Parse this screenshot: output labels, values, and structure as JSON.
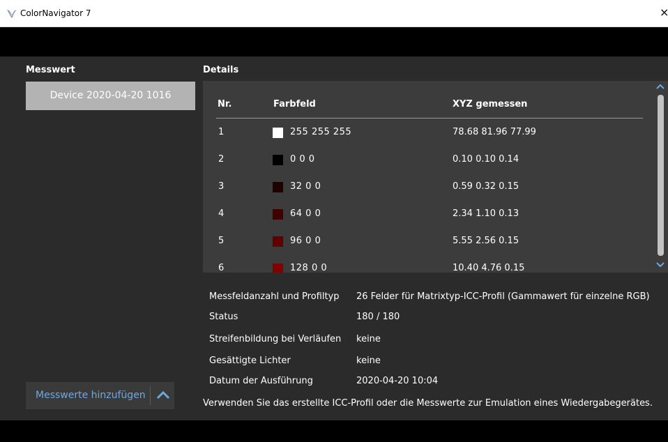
{
  "window": {
    "title": "ColorNavigator 7",
    "close_glyph": "×"
  },
  "left": {
    "heading": "Messwert",
    "items": [
      {
        "label": "Device 2020-04-20 1016",
        "selected": true
      }
    ],
    "add_button": {
      "label": "Messwerte hinzufügen",
      "icon": "chevron-up-icon"
    }
  },
  "details": {
    "heading": "Details",
    "columns": {
      "nr": "Nr.",
      "farbfeld": "Farbfeld",
      "xyz": "XYZ gemessen"
    },
    "rows": [
      {
        "nr": "1",
        "rgb": "255 255 255",
        "color": "#ffffff",
        "xyz": "78.68 81.96 77.99"
      },
      {
        "nr": "2",
        "rgb": "0 0 0",
        "color": "#000000",
        "xyz": "0.10 0.10 0.14"
      },
      {
        "nr": "3",
        "rgb": "32 0 0",
        "color": "#200000",
        "xyz": "0.59 0.32 0.15"
      },
      {
        "nr": "4",
        "rgb": "64 0 0",
        "color": "#400000",
        "xyz": "2.34 1.10 0.13"
      },
      {
        "nr": "5",
        "rgb": "96 0 0",
        "color": "#600000",
        "xyz": "5.55 2.56 0.15"
      },
      {
        "nr": "6",
        "rgb": "128 0 0",
        "color": "#800000",
        "xyz": "10.40 4.76 0.15"
      }
    ],
    "info": [
      {
        "label": "Messfeldanzahl und Profiltyp",
        "value": "26 Felder für Matrixtyp-ICC-Profil (Gammawert für einzelne RGB)"
      },
      {
        "label": "Status",
        "value": "180 / 180"
      },
      {
        "label": "Streifenbildung bei Verläufen",
        "value": "keine"
      },
      {
        "label": "Gesättigte Lichter",
        "value": "keine"
      },
      {
        "label": "Datum der Ausführung",
        "value": "2020-04-20 10:04"
      }
    ],
    "note": "Verwenden Sie das erstellte ICC-Profil oder die Messwerte zur Emulation eines Wiedergabegerätes."
  },
  "colors": {
    "accent": "#6fa8e0",
    "panel": "#2b2b2b",
    "table_bg": "#3c3c3c",
    "selected_item": "#b3b3b3"
  }
}
